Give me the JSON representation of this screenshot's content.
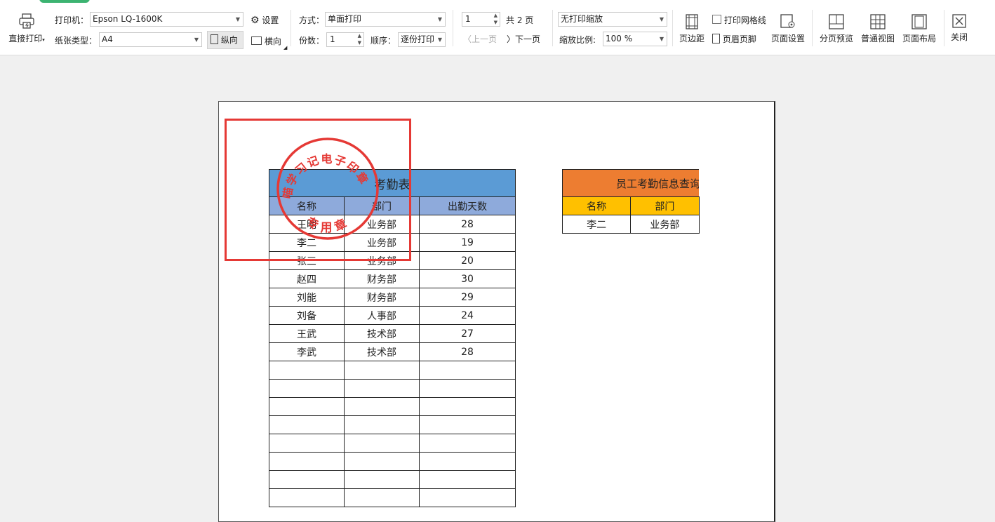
{
  "toolbar": {
    "direct_print": "直接打印",
    "printer_label": "打印机：",
    "printer_value": "Epson LQ-1600K",
    "settings": "设置",
    "paper_label": "纸张类型：",
    "paper_value": "A4",
    "portrait": "纵向",
    "landscape": "横向",
    "mode_label": "方式：",
    "mode_value": "单面打印",
    "copies_label": "份数：",
    "copies_value": "1",
    "order_label": "顺序：",
    "order_value": "逐份打印",
    "page_value": "1",
    "total_pages": "共 2 页",
    "prev_page": "上一页",
    "next_page": "下一页",
    "scale_mode": "无打印缩放",
    "zoom_label": "缩放比例:",
    "zoom_value": "100 %",
    "margins": "页边距",
    "print_gridlines": "打印网格线",
    "header_footer": "页眉页脚",
    "page_setup": "页面设置",
    "page_break_preview": "分页预览",
    "normal_view": "普通视图",
    "page_layout": "页面布局",
    "close": "关闭"
  },
  "sheet1": {
    "title": "考勤表",
    "headers": [
      "名称",
      "部门",
      "出勤天数"
    ],
    "rows": [
      [
        "王明",
        "业务部",
        "28"
      ],
      [
        "李二",
        "业务部",
        "19"
      ],
      [
        "张三",
        "业务部",
        "20"
      ],
      [
        "赵四",
        "财务部",
        "30"
      ],
      [
        "刘能",
        "财务部",
        "29"
      ],
      [
        "刘备",
        "人事部",
        "24"
      ],
      [
        "王武",
        "技术部",
        "27"
      ],
      [
        "李武",
        "技术部",
        "28"
      ]
    ],
    "empty_rows": 8
  },
  "sheet2": {
    "title": "员工考勤信息查询",
    "headers": [
      "名称",
      "部门"
    ],
    "rows": [
      [
        "李二",
        "业务部"
      ]
    ]
  },
  "stamp": {
    "top_text": "喵学习记电子印章",
    "bottom_text": "专用章",
    "color": "#e53935"
  },
  "colors": {
    "title_blue": "#5b9bd5",
    "header_blue": "#8eaadb",
    "title_orange": "#ed7d31",
    "header_yellow": "#ffc000"
  }
}
